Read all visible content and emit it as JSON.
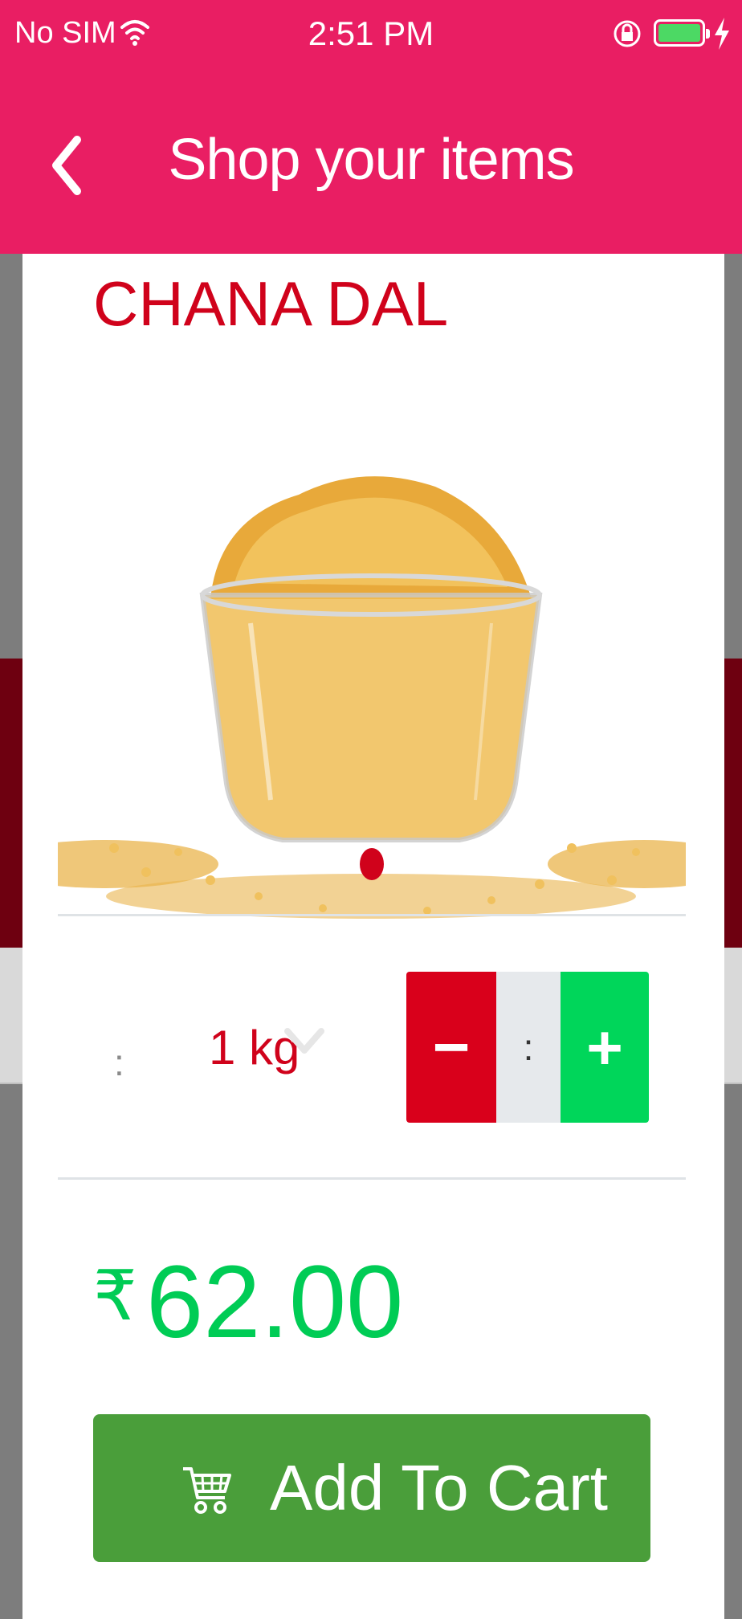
{
  "status_bar": {
    "carrier": "No SIM",
    "time": "2:51 PM",
    "battery_color": "#4cd964"
  },
  "header": {
    "title": "Shop your items",
    "back_icon": "chevron-left-icon",
    "background_color": "#e91e63"
  },
  "product": {
    "name": "CHANA DAL",
    "image_icon": "chana-dal-bowl-image",
    "weight_separator": ":",
    "weight": "1 kg",
    "quantity_display": ":",
    "minus_label": "−",
    "plus_label": "+",
    "currency_symbol": "₹",
    "price": "62.00",
    "name_color": "#d0021b",
    "price_color": "#00cc55"
  },
  "actions": {
    "add_to_cart_label": "Add To Cart",
    "cart_icon": "cart-icon",
    "button_color": "#4a9e3a"
  }
}
